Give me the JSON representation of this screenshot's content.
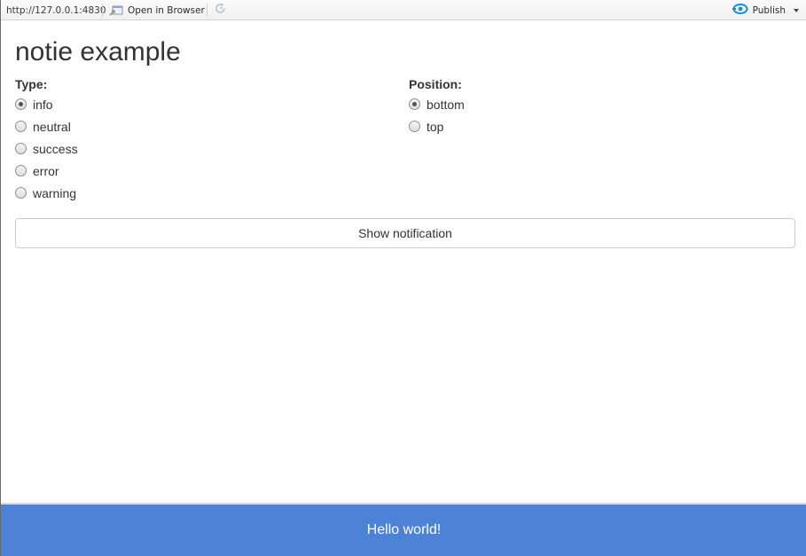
{
  "toolbar": {
    "url": "http://127.0.0.1:4830",
    "open_in_browser_label": "Open in Browser",
    "open_in_browser_icon": "open-in-browser-icon",
    "refresh_icon": "refresh-icon",
    "publish_label": "Publish",
    "publish_icon": "publish-icon"
  },
  "app": {
    "title": "notie example"
  },
  "type_group": {
    "label": "Type:",
    "selected": "info",
    "options": [
      {
        "label": "info",
        "checked": true
      },
      {
        "label": "neutral",
        "checked": false
      },
      {
        "label": "success",
        "checked": false
      },
      {
        "label": "error",
        "checked": false
      },
      {
        "label": "warning",
        "checked": false
      }
    ]
  },
  "position_group": {
    "label": "Position:",
    "selected": "bottom",
    "options": [
      {
        "label": "bottom",
        "checked": true
      },
      {
        "label": "top",
        "checked": false
      }
    ]
  },
  "show_button": {
    "label": "Show notification"
  },
  "notification": {
    "text": "Hello world!",
    "color": "#4d82d6"
  },
  "colors": {
    "publish_accent": "#1a8fd6"
  }
}
